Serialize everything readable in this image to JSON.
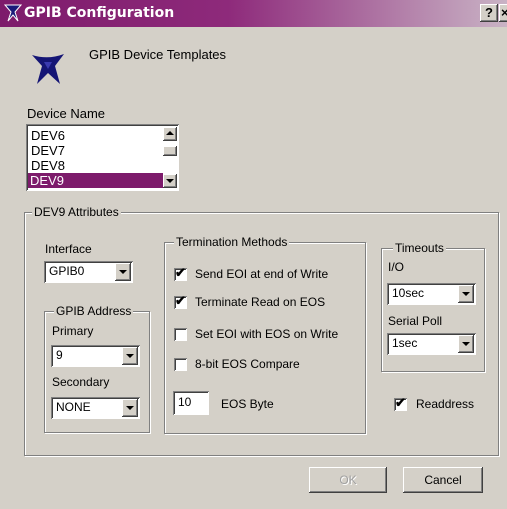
{
  "window": {
    "title": "GPIB Configuration",
    "help_btn": "?",
    "close_btn": "×",
    "titlebar_color": "#7d1b6b",
    "logo_icon": "ni-eagle-logo"
  },
  "header": {
    "subtitle": "GPIB Device Templates",
    "icon": "ni-eagle-logo"
  },
  "device_name": {
    "label": "Device Name",
    "items": [
      "DEV6",
      "DEV7",
      "DEV8",
      "DEV9"
    ],
    "selected": "DEV9",
    "selection_color": "#7d1b6b"
  },
  "attributes": {
    "group_title": "DEV9 Attributes",
    "interface": {
      "label": "Interface",
      "value": "GPIB0"
    },
    "gpib_address": {
      "group_title": "GPIB Address",
      "primary_label": "Primary",
      "primary_value": "9",
      "secondary_label": "Secondary",
      "secondary_value": "NONE"
    },
    "termination": {
      "group_title": "Termination Methods",
      "options": [
        {
          "label": "Send EOI at end of Write",
          "checked": true
        },
        {
          "label": "Terminate Read on EOS",
          "checked": true
        },
        {
          "label": "Set EOI with EOS on Write",
          "checked": false
        },
        {
          "label": "8-bit EOS Compare",
          "checked": false
        }
      ],
      "eos_byte_value": "10",
      "eos_byte_label": "EOS Byte"
    },
    "timeouts": {
      "group_title": "Timeouts",
      "io_label": "I/O",
      "io_value": "10sec",
      "serial_poll_label": "Serial Poll",
      "serial_poll_value": "1sec"
    },
    "readdress": {
      "label": "Readdress",
      "checked": true
    }
  },
  "buttons": {
    "ok": "OK",
    "cancel": "Cancel"
  }
}
